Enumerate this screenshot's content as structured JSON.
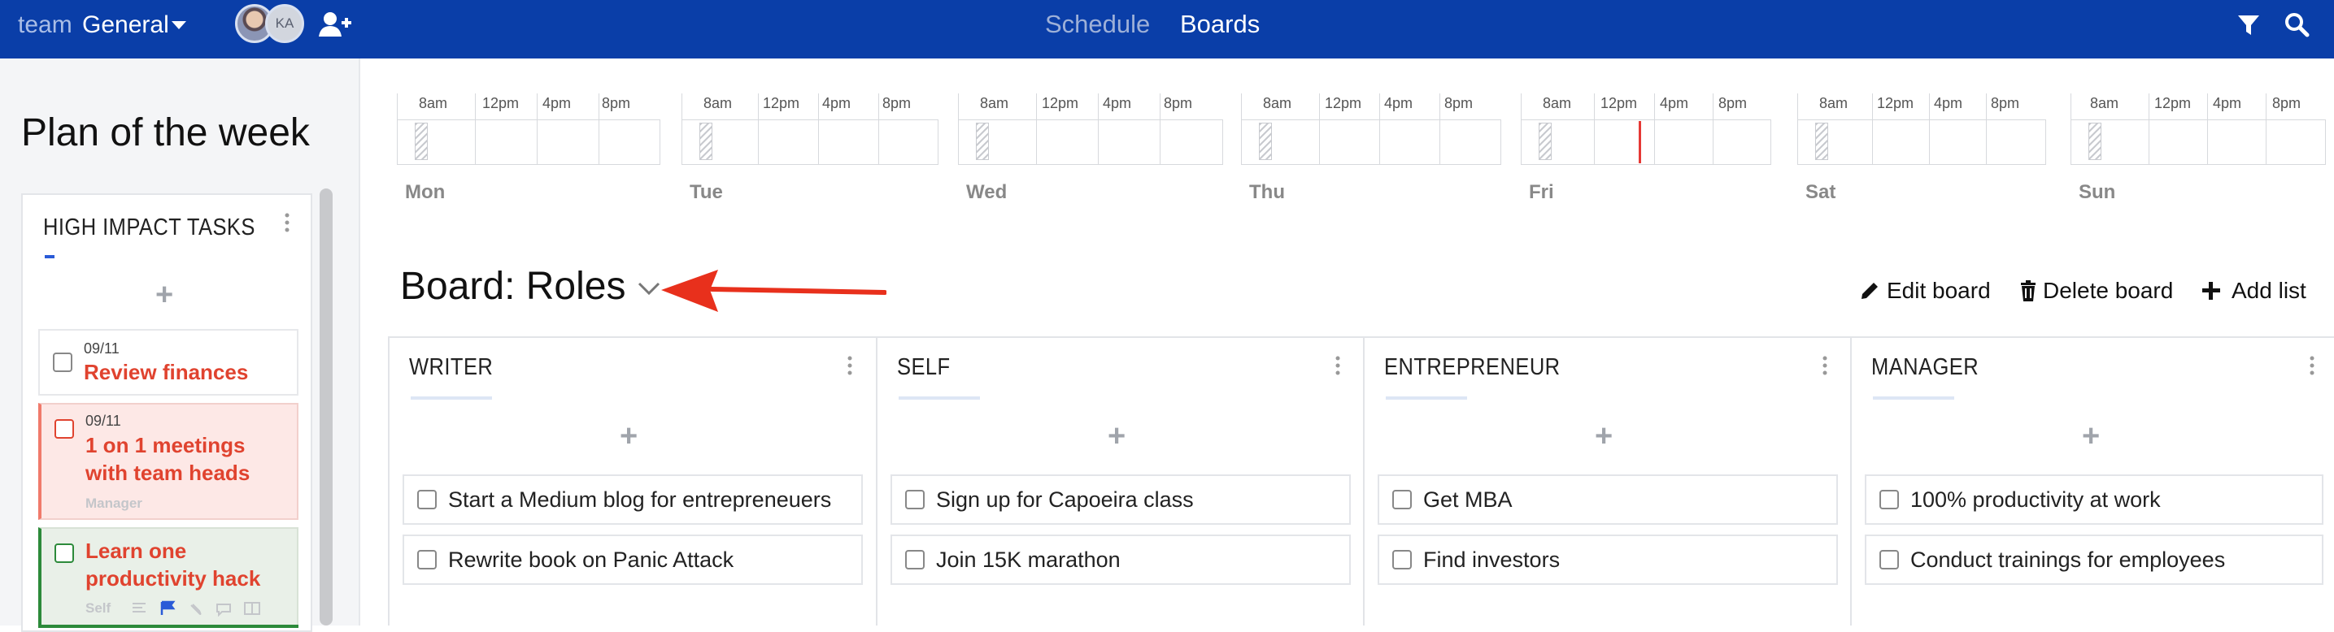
{
  "topbar": {
    "team_label": "team",
    "team_name": "General",
    "avatar_initials": "KA",
    "nav": {
      "schedule": "Schedule",
      "boards": "Boards"
    },
    "icons": [
      "add-member-icon",
      "filter-icon",
      "search-icon"
    ],
    "colors": {
      "bar": "#0a3ea8"
    }
  },
  "sidebar": {
    "title": "Plan of the week",
    "section_title": "HIGH IMPACT TASKS",
    "add_symbol": "+",
    "tasks": [
      {
        "date": "09/11",
        "title": "Review finances",
        "tag": ""
      },
      {
        "date": "09/11",
        "title": "1 on 1 meetings with team heads",
        "tag": "Manager"
      },
      {
        "date": "",
        "title": "Learn one productivity hack",
        "tag": "Self"
      }
    ]
  },
  "schedule": {
    "hours": [
      "8am",
      "12pm",
      "4pm",
      "8pm"
    ],
    "days": [
      "Mon",
      "Tue",
      "Wed",
      "Thu",
      "Fri",
      "Sat",
      "Sun"
    ],
    "now_color": "#e53935"
  },
  "board": {
    "title": "Board: Roles",
    "actions": {
      "edit": "Edit board",
      "delete": "Delete board",
      "add": "Add list"
    },
    "add_symbol": "+",
    "lists": [
      {
        "name": "WRITER",
        "cards": [
          "Start a Medium blog for entrepreneuers",
          "Rewrite book on Panic Attack"
        ]
      },
      {
        "name": "SELF",
        "cards": [
          "Sign up for Capoeira class",
          "Join 15K marathon"
        ]
      },
      {
        "name": "ENTREPRENEUR",
        "cards": [
          "Get MBA",
          "Find investors"
        ]
      },
      {
        "name": "MANAGER",
        "cards": [
          "100% productivity at work",
          "Conduct trainings for employees"
        ]
      }
    ]
  },
  "annotation": {
    "arrow_color": "#e8301c"
  }
}
